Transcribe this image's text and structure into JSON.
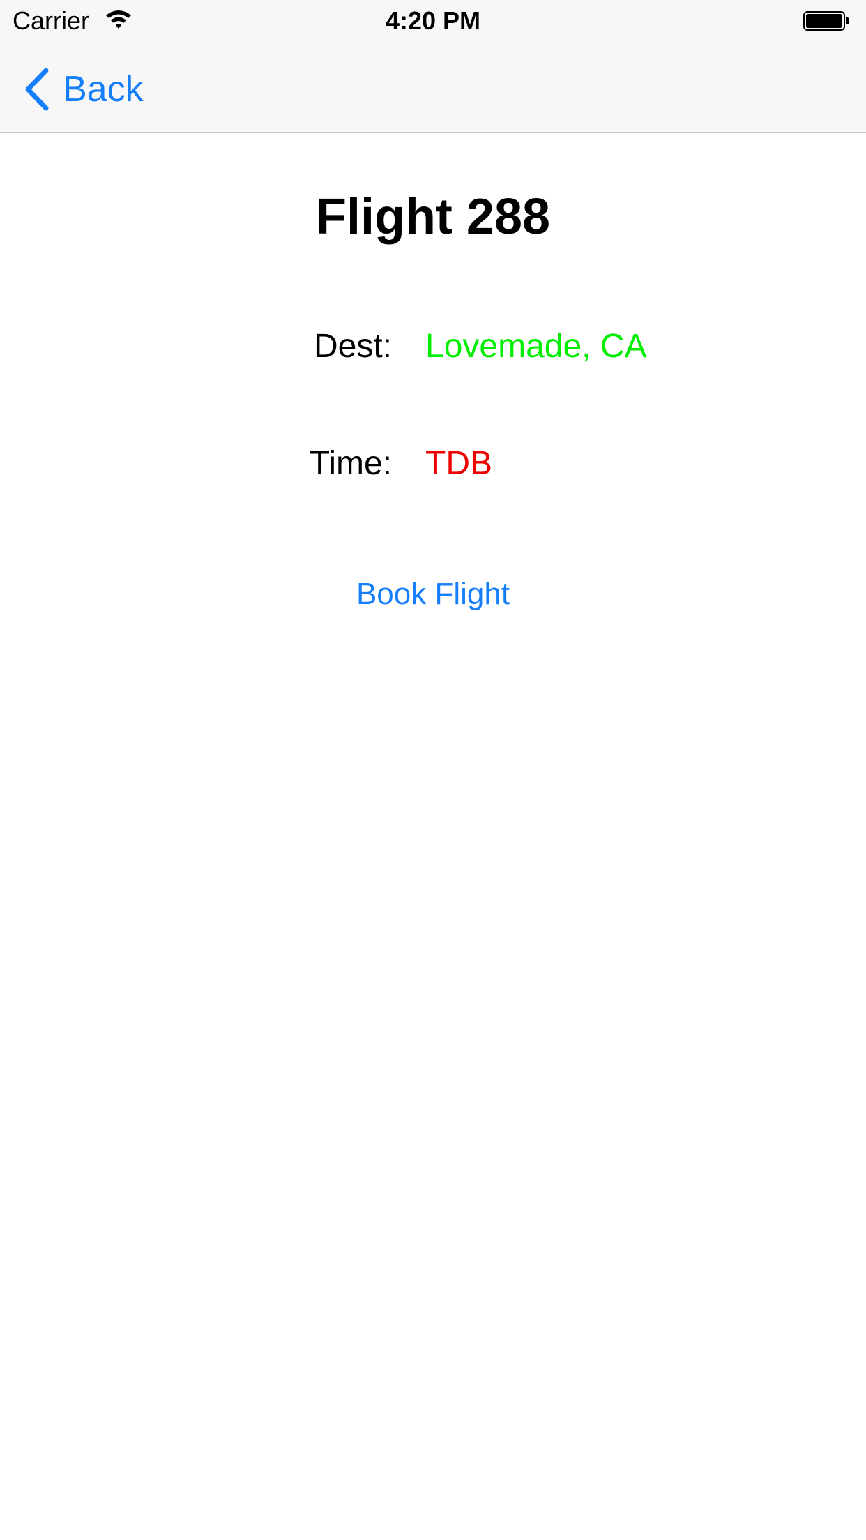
{
  "status_bar": {
    "carrier": "Carrier",
    "time": "4:20 PM",
    "wifi_icon": "wifi-icon",
    "battery_icon": "battery-icon"
  },
  "nav": {
    "back_label": "Back",
    "back_icon": "chevron-left-icon"
  },
  "flight": {
    "title": "Flight 288",
    "dest_label": "Dest:",
    "dest_value": "Lovemade, CA",
    "time_label": "Time:",
    "time_value": "TDB",
    "book_label": "Book Flight"
  },
  "colors": {
    "accent": "#147efb",
    "dest_value": "#00ee00",
    "time_value": "#ee0000"
  }
}
